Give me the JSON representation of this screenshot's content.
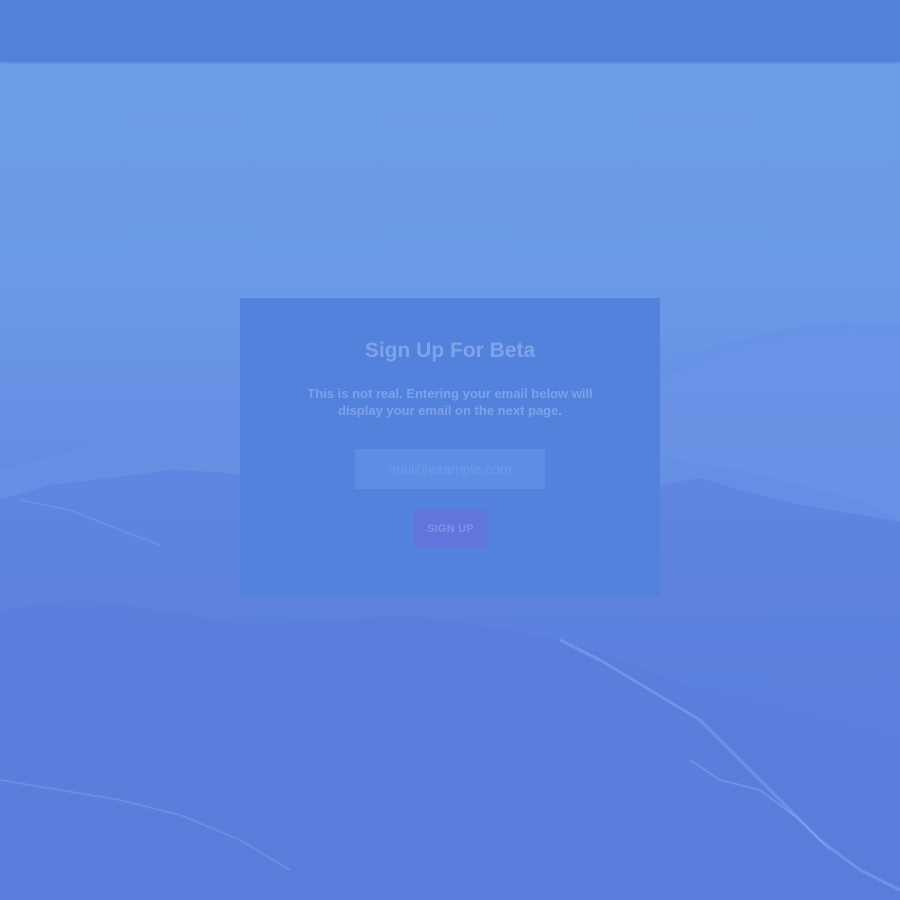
{
  "colors": {
    "background": "#6b9be8",
    "topbar": "#5182d9",
    "card": "#5282db",
    "title_text": "#7da4ea",
    "input": "#5c8ee6",
    "button": "#6275db"
  },
  "signup_card": {
    "title": "Sign Up For Beta",
    "description": "This is not real. Entering your email below will display your email on the next page.",
    "email_placeholder": "mail@example.com",
    "email_value": "",
    "button_label": "SIGN UP"
  }
}
